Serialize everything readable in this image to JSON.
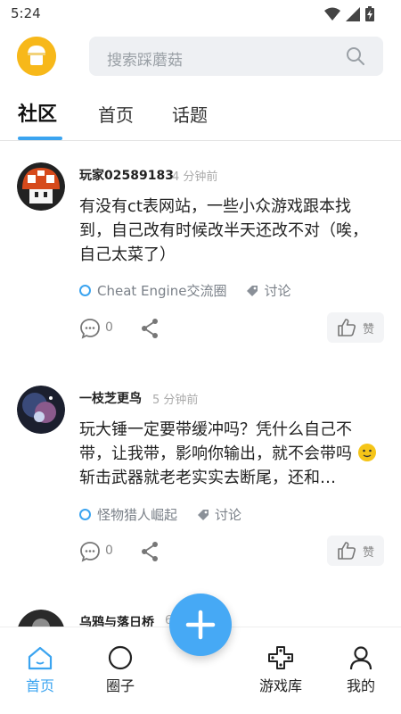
{
  "status_bar": {
    "time": "5:24"
  },
  "search": {
    "placeholder": "搜索踩蘑菇"
  },
  "tabs": [
    {
      "label": "社区",
      "active": true
    },
    {
      "label": "首页",
      "active": false
    },
    {
      "label": "话题",
      "active": false
    }
  ],
  "posts": [
    {
      "user": "玩家02589183",
      "time_ago": "4 分钟前",
      "content": "有没有ct表网站，一些小众游戏跟本找到，自己改有时候改半天还改不对（唉，自己太菜了）",
      "circle": "Cheat Engine交流圈",
      "tag": "讨论",
      "comments": "0",
      "like_label": "赞"
    },
    {
      "user": "一枝芝更鸟",
      "time_ago": "5 分钟前",
      "content": "玩大锤一定要带缓冲吗？凭什么自己不带，让我带，影响你输出，就不会带吗",
      "content_tail": "斩击武器就老老实实去断尾，还和…",
      "circle": "怪物猎人崛起",
      "tag": "讨论",
      "comments": "0",
      "like_label": "赞"
    },
    {
      "user": "乌鸦与落日桥",
      "time_ago": "6"
    }
  ],
  "bottom_nav": [
    {
      "label": "首页",
      "icon": "home-icon",
      "active": true
    },
    {
      "label": "圈子",
      "icon": "circle-icon",
      "active": false
    },
    {
      "label": "游戏库",
      "icon": "gamepad-icon",
      "active": false
    },
    {
      "label": "我的",
      "icon": "person-icon",
      "active": false
    }
  ],
  "colors": {
    "accent": "#3ba4f0",
    "fab": "#46a9f5"
  }
}
